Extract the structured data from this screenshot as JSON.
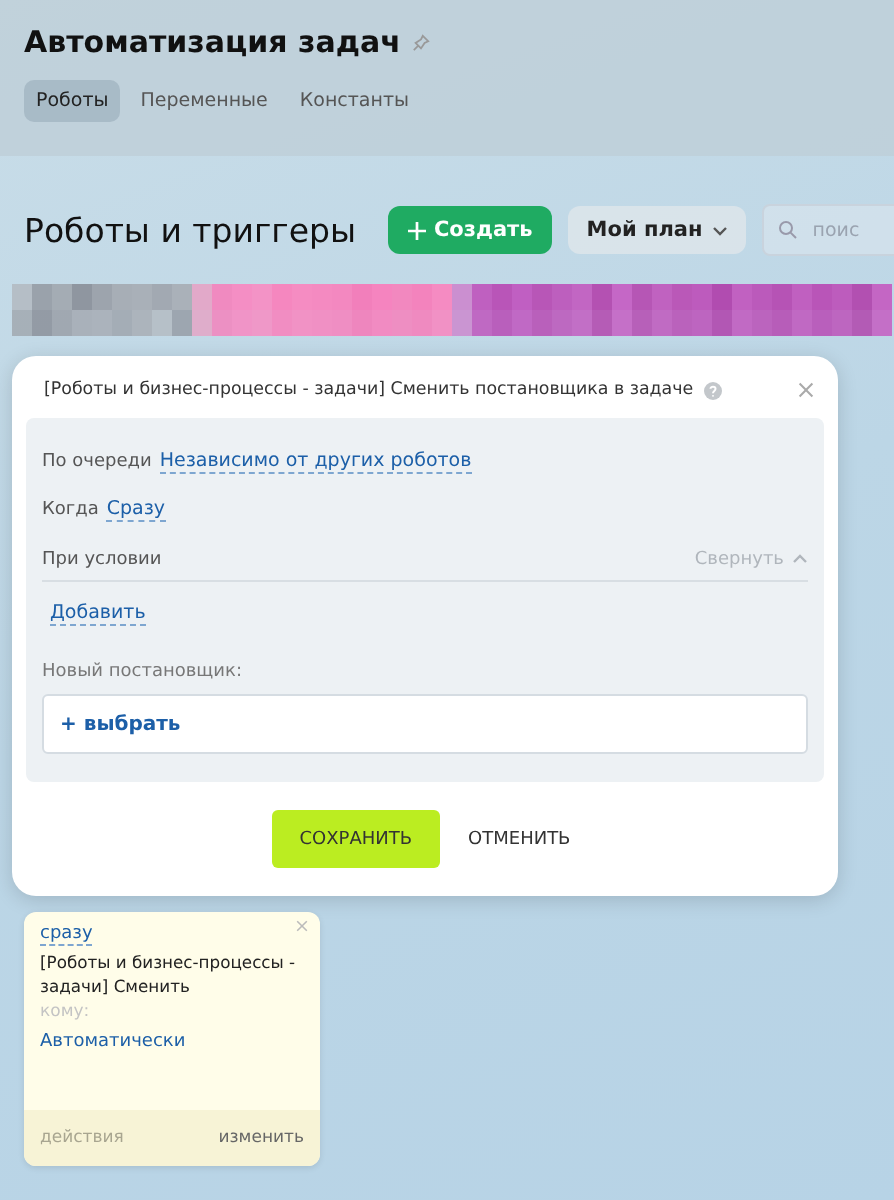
{
  "page_title": "Автоматизация задач",
  "tabs": [
    {
      "label": "Роботы",
      "selected": true
    },
    {
      "label": "Переменные",
      "selected": false
    },
    {
      "label": "Константы",
      "selected": false
    }
  ],
  "toolbar": {
    "heading": "Роботы и триггеры",
    "create_button": "Создать",
    "plan_button": "Мой план",
    "search": {
      "placeholder": "поис"
    }
  },
  "dialog": {
    "title": "[Роботы и бизнес-процессы - задачи] Сменить постановщика в задаче",
    "fields": [
      {
        "label": "По очереди",
        "value": "Независимо от других роботов"
      },
      {
        "label": "Когда",
        "value": "Сразу"
      }
    ],
    "condition": {
      "label": "При условии",
      "toggle": "Свернуть",
      "expanded": true,
      "add_link": "Добавить"
    },
    "assignee": {
      "label": "Новый постановщик:",
      "select_link": "+ выбрать"
    },
    "save_button": "СОХРАНИТЬ",
    "cancel_button": "ОТМЕНИТЬ"
  },
  "robot_card": {
    "when": "сразу",
    "title": "[Роботы и бизнес-процессы - задачи] Сменить",
    "to_label": "кому:",
    "to_value": "Автоматически",
    "actions_label": "действия",
    "edit_link": "изменить"
  }
}
